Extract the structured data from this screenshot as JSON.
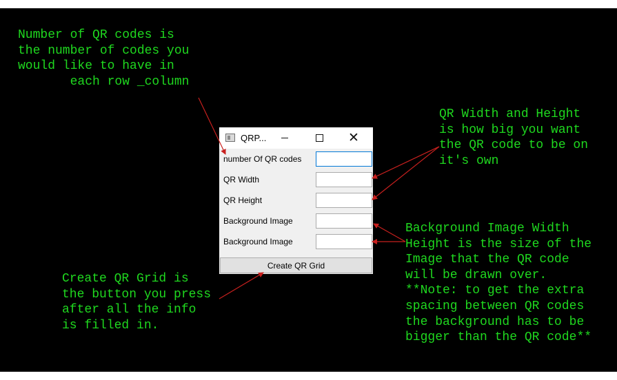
{
  "annotations": {
    "qr_count_note": "Number of QR codes is\nthe number of codes you\nwould like to have in\n       each row _column",
    "qr_size_note": "QR Width and Height\nis how big you want\nthe QR code to be on\nit's own",
    "background_note": "Background Image Width\nHeight is the size of the\nImage that the QR code\nwill be drawn over.\n**Note: to get the extra\nspacing between QR codes\nthe background has to be\nbigger than the QR code**",
    "create_note": "Create QR Grid is\nthe button you press\nafter all the info\nis filled in."
  },
  "window": {
    "title": "QRP...",
    "fields": [
      {
        "label": "number Of QR codes",
        "value": ""
      },
      {
        "label": "QR Width",
        "value": ""
      },
      {
        "label": "QR Height",
        "value": ""
      },
      {
        "label": "Background Image",
        "value": ""
      },
      {
        "label": "Background Image",
        "value": ""
      }
    ],
    "create_button": "Create QR Grid"
  },
  "colors": {
    "annotation_text": "#1fd81f",
    "arrow": "#c8201e",
    "background": "#000000",
    "window": "#f0f0f0",
    "focus_border": "#0078d7"
  }
}
